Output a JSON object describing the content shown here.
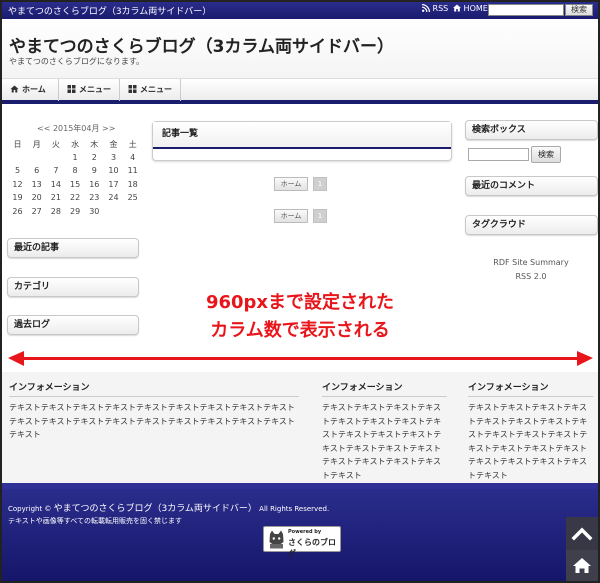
{
  "topbar": {
    "title": "やまてつのさくらブログ（3カラム両サイドバー）",
    "rss": "RSS",
    "home": "HOME",
    "search_button": "検索"
  },
  "header": {
    "title": "やまてつのさくらブログ（3カラム両サイドバー）",
    "description": "やまてつのさくらブログになります。"
  },
  "nav": {
    "items": [
      {
        "label": "ホーム",
        "icon": "home-icon"
      },
      {
        "label": "メニュー",
        "icon": "grid-icon"
      },
      {
        "label": "メニュー",
        "icon": "grid-icon"
      }
    ]
  },
  "left_sidebar": {
    "calendar": {
      "header": "<< 2015年04月 >>",
      "weekdays": [
        "日",
        "月",
        "火",
        "水",
        "木",
        "金",
        "土"
      ],
      "rows": [
        [
          "",
          "",
          "",
          "1",
          "2",
          "3",
          "4"
        ],
        [
          "5",
          "6",
          "7",
          "8",
          "9",
          "10",
          "11"
        ],
        [
          "12",
          "13",
          "14",
          "15",
          "16",
          "17",
          "18"
        ],
        [
          "19",
          "20",
          "21",
          "22",
          "23",
          "24",
          "25"
        ],
        [
          "26",
          "27",
          "28",
          "29",
          "30",
          "",
          ""
        ]
      ]
    },
    "recent_articles": "最近の記事",
    "categories": "カテゴリ",
    "archives": "過去ログ"
  },
  "main": {
    "article_list_title": "記事一覧",
    "pager_home": "ホーム",
    "pager_page": "1"
  },
  "right_sidebar": {
    "search_title": "検索ボックス",
    "search_button": "検索",
    "recent_comments": "最近のコメント",
    "tag_cloud": "タグクラウド",
    "rdf": "RDF Site Summary",
    "rss": "RSS 2.0"
  },
  "annotation": {
    "line1": "960pxまで設定された",
    "line2": "カラム数で表示される",
    "color": "#e8161b"
  },
  "footer_widgets": [
    {
      "title": "インフォメーション",
      "text": "テキストテキストテキストテキストテキストテキストテキストテキストテキストテキストテキストテキストテキストテキストテキストテキストテキストテキストテキスト"
    },
    {
      "title": "インフォメーション",
      "text": "テキストテキストテキストテキストテキストテキストテキストテキストテキストテキストテキストテキストテキストテキストテキストテキストテキストテキストテキストテキスト"
    },
    {
      "title": "インフォメーション",
      "text": "テキストテキストテキストテキストテキストテキストテキストテキストテキストテキストテキストテキストテキストテキストテキストテキストテキストテキストテキストテキスト"
    }
  ],
  "footer": {
    "copyright_prefix": "Copyright © ",
    "copyright_name": "やまてつのさくらブログ（3カラム両サイドバー）",
    "copyright_suffix": " All Rights Reserved.",
    "notice": "テキストや画像等すべての転載転用販売を固く禁じます",
    "badge_powered": "Powered by",
    "badge_name": "さくらのブログ"
  },
  "colors": {
    "brand_navy": "#1a1c6e",
    "accent_red": "#e8161b"
  }
}
